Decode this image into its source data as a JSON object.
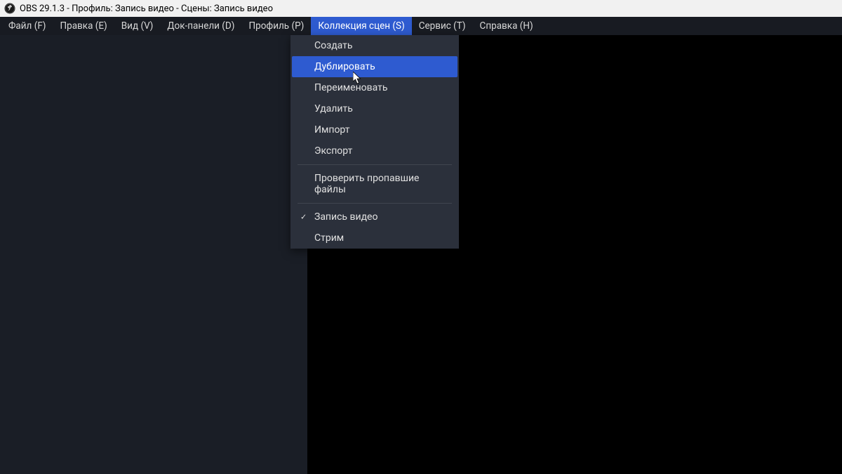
{
  "titlebar": {
    "text": "OBS 29.1.3 - Профиль: Запись видео - Сцены: Запись видео"
  },
  "menubar": {
    "items": [
      {
        "label": "Файл (F)",
        "active": false
      },
      {
        "label": "Правка (E)",
        "active": false
      },
      {
        "label": "Вид (V)",
        "active": false
      },
      {
        "label": "Док-панели (D)",
        "active": false
      },
      {
        "label": "Профиль (P)",
        "active": false
      },
      {
        "label": "Коллекция сцен (S)",
        "active": true
      },
      {
        "label": "Сервис (T)",
        "active": false
      },
      {
        "label": "Справка (H)",
        "active": false
      }
    ]
  },
  "dropdown": {
    "items": [
      {
        "label": "Создать",
        "highlighted": false,
        "checked": false,
        "separator": false
      },
      {
        "label": "Дублировать",
        "highlighted": true,
        "checked": false,
        "separator": false
      },
      {
        "label": "Переименовать",
        "highlighted": false,
        "checked": false,
        "separator": false
      },
      {
        "label": "Удалить",
        "highlighted": false,
        "checked": false,
        "separator": false
      },
      {
        "label": "Импорт",
        "highlighted": false,
        "checked": false,
        "separator": false
      },
      {
        "label": "Экспорт",
        "highlighted": false,
        "checked": false,
        "separator": false
      },
      {
        "separator": true
      },
      {
        "label": "Проверить пропавшие файлы",
        "highlighted": false,
        "checked": false,
        "separator": false
      },
      {
        "separator": true
      },
      {
        "label": "Запись видео",
        "highlighted": false,
        "checked": true,
        "separator": false
      },
      {
        "label": "Стрим",
        "highlighted": false,
        "checked": false,
        "separator": false
      }
    ]
  }
}
